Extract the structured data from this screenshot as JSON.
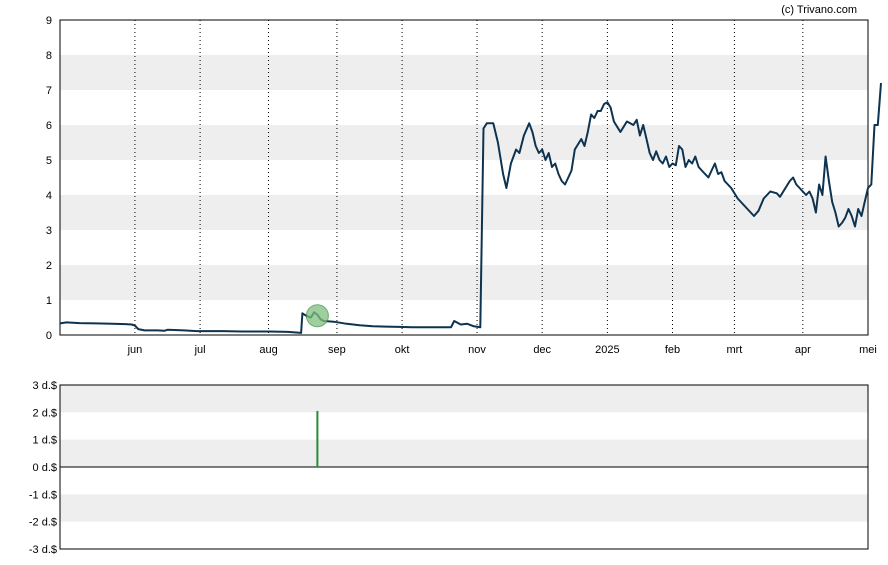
{
  "credit": "(c) Trivano.com",
  "colors": {
    "price_line": "#0d3350",
    "band": "#eeeeee",
    "bar": "#2a8a3a",
    "marker_fill": "#7fbf7f",
    "marker_stroke": "#3f8f3f"
  },
  "chart_data": [
    {
      "type": "line",
      "title": "",
      "xlabel": "",
      "ylabel": "",
      "x_ticks": [
        "jun",
        "jul",
        "aug",
        "sep",
        "okt",
        "nov",
        "dec",
        "2025",
        "feb",
        "mrt",
        "apr",
        "mei"
      ],
      "x_tick_pos": [
        1.15,
        2.15,
        3.2,
        4.25,
        5.25,
        6.4,
        7.4,
        8.4,
        9.4,
        10.35,
        11.4,
        12.4
      ],
      "x_range": [
        0.0,
        12.4
      ],
      "ylim": [
        0,
        9
      ],
      "y_ticks": [
        "0",
        "1",
        "2",
        "3",
        "4",
        "5",
        "6",
        "7",
        "8",
        "9"
      ],
      "grid": "horizontal bands, vertical dotted lines",
      "series": [
        {
          "values": [
            [
              0.0,
              0.33
            ],
            [
              0.1,
              0.36
            ],
            [
              0.3,
              0.34
            ],
            [
              0.55,
              0.33
            ],
            [
              0.8,
              0.32
            ],
            [
              1.0,
              0.31
            ],
            [
              1.1,
              0.3
            ],
            [
              1.15,
              0.27
            ],
            [
              1.2,
              0.17
            ],
            [
              1.3,
              0.13
            ],
            [
              1.5,
              0.13
            ],
            [
              1.6,
              0.12
            ],
            [
              1.65,
              0.15
            ],
            [
              1.9,
              0.13
            ],
            [
              2.1,
              0.11
            ],
            [
              2.5,
              0.11
            ],
            [
              2.8,
              0.1
            ],
            [
              3.2,
              0.1
            ],
            [
              3.5,
              0.09
            ],
            [
              3.7,
              0.06
            ],
            [
              3.72,
              0.62
            ],
            [
              3.78,
              0.55
            ],
            [
              3.85,
              0.5
            ],
            [
              3.9,
              0.65
            ],
            [
              3.95,
              0.58
            ],
            [
              4.0,
              0.45
            ],
            [
              4.05,
              0.4
            ],
            [
              4.2,
              0.38
            ],
            [
              4.4,
              0.32
            ],
            [
              4.6,
              0.28
            ],
            [
              4.8,
              0.25
            ],
            [
              5.0,
              0.24
            ],
            [
              5.2,
              0.23
            ],
            [
              5.4,
              0.22
            ],
            [
              5.6,
              0.22
            ],
            [
              5.8,
              0.22
            ],
            [
              6.0,
              0.22
            ],
            [
              6.05,
              0.4
            ],
            [
              6.15,
              0.3
            ],
            [
              6.25,
              0.32
            ],
            [
              6.35,
              0.25
            ],
            [
              6.45,
              0.22
            ],
            [
              6.5,
              5.9
            ],
            [
              6.55,
              6.05
            ],
            [
              6.65,
              6.05
            ],
            [
              6.72,
              5.5
            ],
            [
              6.8,
              4.6
            ],
            [
              6.85,
              4.2
            ],
            [
              6.92,
              4.9
            ],
            [
              7.0,
              5.3
            ],
            [
              7.05,
              5.2
            ],
            [
              7.12,
              5.7
            ],
            [
              7.2,
              6.05
            ],
            [
              7.25,
              5.8
            ],
            [
              7.3,
              5.4
            ],
            [
              7.35,
              5.2
            ],
            [
              7.4,
              5.3
            ],
            [
              7.45,
              5.0
            ],
            [
              7.5,
              5.2
            ],
            [
              7.55,
              4.8
            ],
            [
              7.6,
              4.9
            ],
            [
              7.65,
              4.6
            ],
            [
              7.7,
              4.4
            ],
            [
              7.75,
              4.3
            ],
            [
              7.8,
              4.5
            ],
            [
              7.85,
              4.7
            ],
            [
              7.9,
              5.3
            ],
            [
              8.0,
              5.6
            ],
            [
              8.05,
              5.4
            ],
            [
              8.1,
              5.8
            ],
            [
              8.15,
              6.3
            ],
            [
              8.2,
              6.2
            ],
            [
              8.25,
              6.4
            ],
            [
              8.3,
              6.4
            ],
            [
              8.35,
              6.6
            ],
            [
              8.4,
              6.65
            ],
            [
              8.45,
              6.5
            ],
            [
              8.5,
              6.1
            ],
            [
              8.6,
              5.8
            ],
            [
              8.7,
              6.1
            ],
            [
              8.8,
              6.0
            ],
            [
              8.85,
              6.15
            ],
            [
              8.9,
              5.7
            ],
            [
              8.95,
              6.0
            ],
            [
              9.0,
              5.6
            ],
            [
              9.05,
              5.2
            ],
            [
              9.1,
              5.0
            ],
            [
              9.15,
              5.25
            ],
            [
              9.2,
              5.0
            ],
            [
              9.25,
              4.9
            ],
            [
              9.3,
              5.1
            ],
            [
              9.35,
              4.8
            ],
            [
              9.4,
              4.9
            ],
            [
              9.45,
              4.85
            ],
            [
              9.5,
              5.4
            ],
            [
              9.55,
              5.3
            ],
            [
              9.6,
              4.8
            ],
            [
              9.65,
              5.0
            ],
            [
              9.7,
              4.9
            ],
            [
              9.75,
              5.1
            ],
            [
              9.8,
              4.8
            ],
            [
              9.85,
              4.7
            ],
            [
              9.9,
              4.6
            ],
            [
              9.95,
              4.5
            ],
            [
              10.0,
              4.7
            ],
            [
              10.05,
              4.9
            ],
            [
              10.1,
              4.6
            ],
            [
              10.15,
              4.65
            ],
            [
              10.2,
              4.4
            ],
            [
              10.3,
              4.2
            ],
            [
              10.4,
              3.9
            ],
            [
              10.5,
              3.7
            ],
            [
              10.6,
              3.5
            ],
            [
              10.65,
              3.4
            ],
            [
              10.72,
              3.55
            ],
            [
              10.8,
              3.9
            ],
            [
              10.9,
              4.1
            ],
            [
              11.0,
              4.05
            ],
            [
              11.05,
              3.95
            ],
            [
              11.1,
              4.1
            ],
            [
              11.2,
              4.4
            ],
            [
              11.25,
              4.5
            ],
            [
              11.3,
              4.3
            ],
            [
              11.35,
              4.2
            ],
            [
              11.4,
              4.1
            ],
            [
              11.45,
              4.0
            ],
            [
              11.5,
              4.1
            ],
            [
              11.55,
              3.9
            ],
            [
              11.6,
              3.5
            ],
            [
              11.65,
              4.3
            ],
            [
              11.7,
              4.0
            ],
            [
              11.75,
              5.1
            ],
            [
              11.8,
              4.4
            ],
            [
              11.85,
              3.8
            ],
            [
              11.9,
              3.5
            ],
            [
              11.95,
              3.1
            ],
            [
              12.0,
              3.2
            ],
            [
              12.05,
              3.35
            ],
            [
              12.1,
              3.6
            ],
            [
              12.15,
              3.4
            ],
            [
              12.2,
              3.1
            ],
            [
              12.25,
              3.6
            ],
            [
              12.3,
              3.4
            ],
            [
              12.35,
              3.8
            ],
            [
              12.4,
              4.2
            ],
            [
              12.45,
              4.3
            ],
            [
              12.5,
              6.0
            ],
            [
              12.55,
              6.0
            ],
            [
              12.6,
              7.2
            ]
          ]
        }
      ],
      "marker": {
        "x": 3.95,
        "y": 0.55
      }
    },
    {
      "type": "bar",
      "title": "",
      "xlabel": "",
      "ylabel": "",
      "ylim": [
        -3,
        3
      ],
      "y_ticks": [
        "3 d.$",
        "2 d.$",
        "1 d.$",
        "0 d.$",
        "-1 d.$",
        "-2 d.$",
        "-3 d.$"
      ],
      "bars": [
        {
          "x": 3.95,
          "value": 2.05
        }
      ]
    }
  ]
}
